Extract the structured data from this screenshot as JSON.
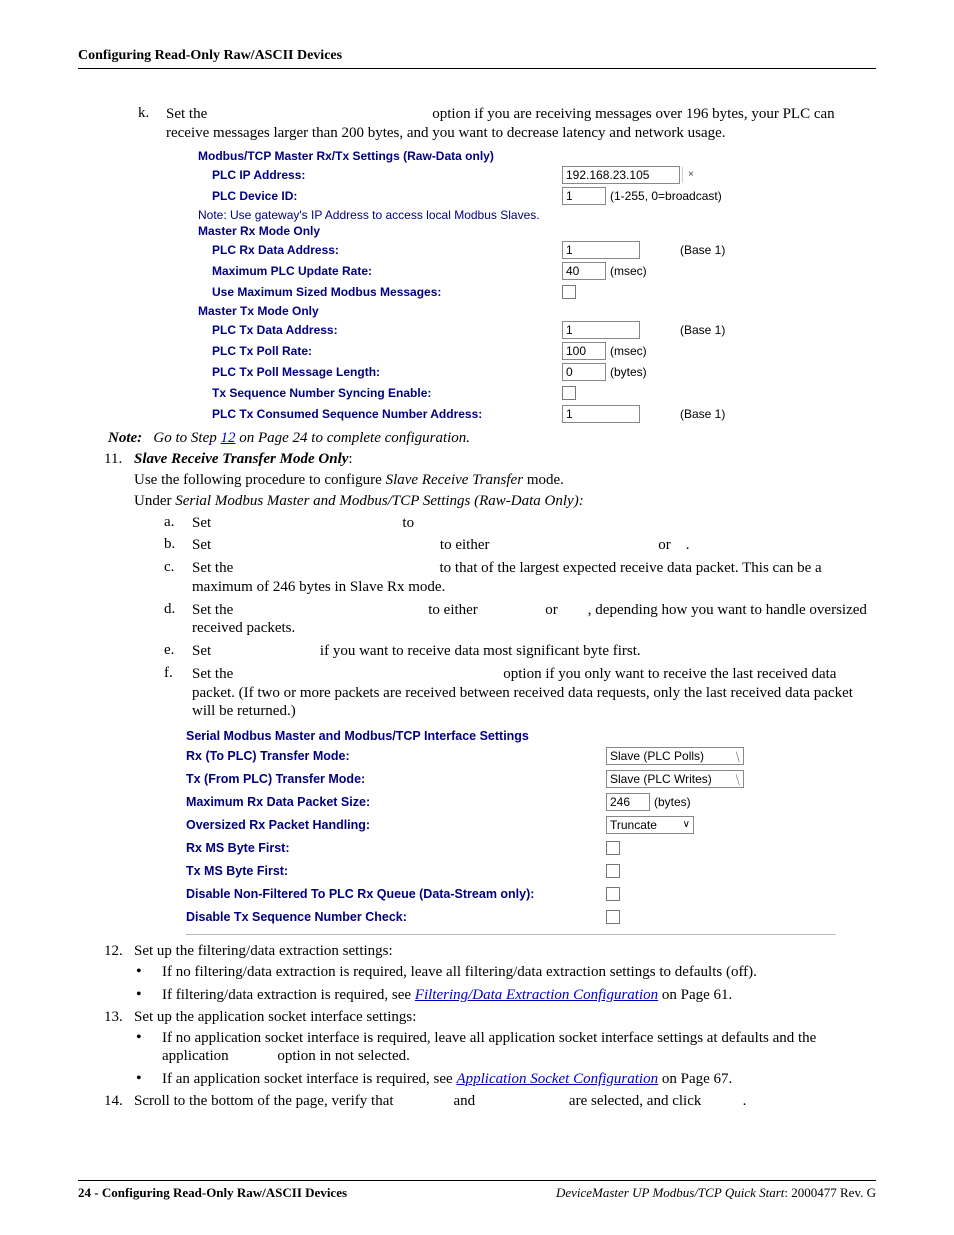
{
  "header": {
    "title": "Configuring Read-Only Raw/ASCII Devices"
  },
  "stepK": {
    "marker": "k.",
    "text": "Set the                                                            option if you are receiving messages over 196 bytes, your PLC can receive messages larger than 200 bytes, and you want to decrease latency and network usage."
  },
  "panel1": {
    "heading": "Modbus/TCP Master Rx/Tx Settings (Raw-Data only)",
    "ip_label": "PLC IP Address:",
    "ip_value": "192.168.23.105",
    "devid_label": "PLC Device ID:",
    "devid_value": "1",
    "devid_note": "(1-255, 0=broadcast)",
    "note": "Note: Use gateway's IP Address to access local Modbus Slaves.",
    "rx_section": "Master Rx Mode Only",
    "rx_addr_label": "PLC Rx Data Address:",
    "rx_addr_value": "1",
    "base1": "(Base 1)",
    "max_rate_label": "Maximum PLC Update Rate:",
    "max_rate_value": "40",
    "msec": "(msec)",
    "use_max_label": "Use Maximum Sized Modbus Messages:",
    "tx_section": "Master Tx Mode Only",
    "tx_addr_label": "PLC Tx Data Address:",
    "tx_addr_value": "1",
    "tx_poll_label": "PLC Tx Poll Rate:",
    "tx_poll_value": "100",
    "tx_msglen_label": "PLC Tx Poll Message Length:",
    "tx_msglen_value": "0",
    "bytes": "(bytes)",
    "tx_sync_label": "Tx Sequence Number Syncing Enable:",
    "tx_consumed_label": "PLC Tx Consumed Sequence Number Address:",
    "tx_consumed_value": "1"
  },
  "note_line": {
    "label": "Note:",
    "before": "Go to Step ",
    "link": "12",
    "after": " on Page 24 to complete configuration."
  },
  "step11": {
    "marker": "11.",
    "title": "Slave Receive Transfer Mode Only",
    "colon": ":",
    "line1": [
      "Use the following procedure to configure ",
      "Slave Receive Transfer",
      " mode."
    ],
    "line2": [
      "Under ",
      "Serial Modbus Master and Modbus/TCP Settings (Raw-Data Only):"
    ],
    "a": "Set                                                   to",
    "b": "Set                                                             to either                                             or    .",
    "c": "Set the                                                       to that of the largest expected receive data packet. This can be a maximum of 246 bytes in Slave Rx mode.",
    "d": "Set the                                                    to either                  or        , depending how you want to handle oversized received packets.",
    "e": "Set                             if you want to receive data most significant byte first.",
    "f": "Set the                                                                        option if you only want to receive the last received data packet. (If two or more packets are received between received data requests, only the last received data packet will be returned.)"
  },
  "panel2": {
    "heading": "Serial Modbus Master and Modbus/TCP Interface Settings",
    "rx_mode_label": "Rx (To PLC) Transfer Mode:",
    "rx_mode_value": "Slave (PLC Polls)",
    "tx_mode_label": "Tx (From PLC) Transfer Mode:",
    "tx_mode_value": "Slave (PLC Writes)",
    "max_rx_label": "Maximum Rx Data Packet Size:",
    "max_rx_value": "246",
    "bytes": "(bytes)",
    "oversize_label": "Oversized Rx Packet Handling:",
    "oversize_value": "Truncate",
    "rx_msb_label": "Rx MS Byte First:",
    "tx_msb_label": "Tx MS Byte First:",
    "disable_nf_label": "Disable Non-Filtered To PLC Rx Queue (Data-Stream only):",
    "disable_tx_label": "Disable Tx Sequence Number Check:"
  },
  "step12": {
    "marker": "12.",
    "lead": "Set up the filtering/data extraction settings:",
    "b1": "If no filtering/data extraction is required, leave all filtering/data extraction settings to defaults (off).",
    "b2_before": "If filtering/data extraction is required, see ",
    "b2_link": "Filtering/Data Extraction Configuration",
    "b2_after": " on Page 61."
  },
  "step13": {
    "marker": "13.",
    "lead": "Set up the application socket interface settings:",
    "b1": "If no application socket interface is required, leave all application socket interface settings at defaults and the application             option in not selected.",
    "b2_before": "If an application socket interface is required, see ",
    "b2_link": "Application Socket Configuration",
    "b2_after": " on Page 67."
  },
  "step14": {
    "marker": "14.",
    "text": "Scroll to the bottom of the page, verify that                and                         are selected, and click           ."
  },
  "footer": {
    "left": "24 - Configuring Read-Only Raw/ASCII Devices",
    "right_em": "DeviceMaster UP Modbus/TCP Quick Start",
    "right_plain": ": 2000477 Rev. G"
  }
}
